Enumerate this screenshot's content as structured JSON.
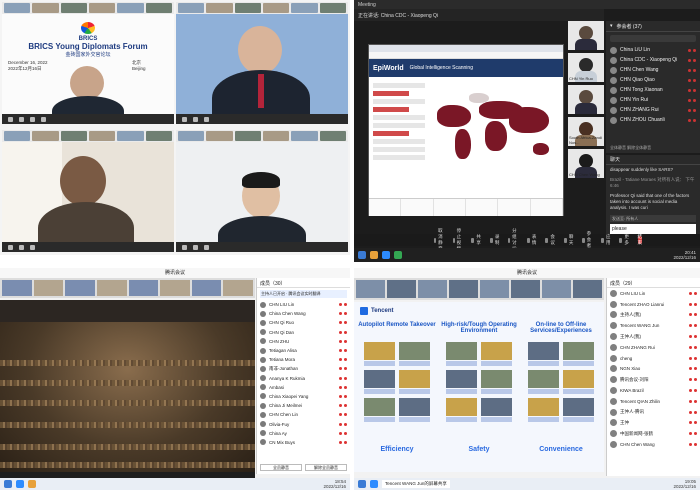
{
  "forum": {
    "org": "BRICS",
    "title": "BRICS Young Diplomats Forum",
    "subtitle_cn": "金砖国家外交官论坛",
    "date_en": "December 16, 2022",
    "date_cn": "2022年12月16日",
    "place_en": "Beijing",
    "place_cn": "北京"
  },
  "meeting_window": {
    "tab_title": "正在讲话: China CDC - Xiaopeng Qi",
    "meeting_title": "Meeting",
    "participants_title": "参会者 (37)",
    "participants": [
      {
        "name": "China LiU Lin",
        "sub": "(主持人, 我)"
      },
      {
        "name": "China CDC - Xiaopeng Qi",
        "sub": ""
      },
      {
        "name": "CHN Chen Wang",
        "sub": ""
      },
      {
        "name": "CHN Qiao Qiao",
        "sub": ""
      },
      {
        "name": "CHN Tong Xiaonan",
        "sub": ""
      },
      {
        "name": "CHN Yin Rui",
        "sub": ""
      },
      {
        "name": "CHN ZHANG Rui",
        "sub": ""
      },
      {
        "name": "CHN ZHOU Chuanli",
        "sub": ""
      }
    ],
    "participants_foot": "全体静音   解除全体静音",
    "chat_title": "聊天",
    "chat_messages": [
      "disappear suddenly like SARS?",
      "Brazil - Tatiane Moraes 对所有人说： 下午 6:46",
      "Professor Qi said that one of the factors taken into account is social media analysis. I was curi"
    ],
    "chat_to": "发送至: 所有人",
    "chat_input": "please",
    "video_labels": [
      "",
      "CHN Yin Ruo",
      "",
      "South Africa-Zandi Nos...",
      "CHN Chen Wang"
    ],
    "shared_site": {
      "logo": "EpiWorld",
      "subtitle": "Global Intelligence Scanning"
    },
    "toolbar": [
      "取消静音",
      "停止视频",
      "共享",
      "录制",
      "分组讨论",
      "表情",
      "会议",
      "聊天",
      "参会者",
      "应用",
      "更多",
      "结束"
    ],
    "clock": [
      "20:41",
      "2022/12/16"
    ]
  },
  "q3_window": {
    "title": "腾讯会议",
    "panel_title": "成员（30）",
    "banner": "主持人已开启 · 腾讯会议实时翻译",
    "members": [
      "CHN LIU Lin",
      "China Chen Wang",
      "CHN Qi Ruo",
      "CHN Qi Dan",
      "CHN ZHU",
      "Tetiagan Alisa",
      "Tetiana Mora",
      "南非-Jonathan",
      "Ananya K Rukmia",
      "Ambasi",
      "China Xiaopei Yang",
      "China Ji Meilmei",
      "CHN Chen Lin",
      "Olivia-Fuy",
      "China Ay",
      "CN Mix Buys"
    ],
    "buttons": [
      "全员静音",
      "解除全员静音"
    ],
    "clock": [
      "18:54",
      "2022/12/16"
    ]
  },
  "q4_window": {
    "title": "腾讯会议",
    "panel_title": "成员（29）",
    "members": [
      "CHN LIU Lin",
      "Tencent ZHAO Lianrui",
      "主持人(我)",
      "Tencent WANG Jun",
      "王仲人(我)",
      "CHN ZHANG Rui",
      "cheng",
      "NGN Xiao",
      "腾讯会议-刘阳",
      "KIWA Brazil",
      "Tencent QIAN Zhilin",
      "王仲人-腾讯",
      "王仲",
      "中国新闻网-张鹤",
      "CHN Chen Wang"
    ],
    "slide": {
      "brand": "Tencent",
      "cols": [
        {
          "title": "Autopilot Remote Takeover",
          "foot": "Efficiency"
        },
        {
          "title": "High-risk/Tough Operating Environment",
          "foot": "Safety"
        },
        {
          "title": "On-line to Off-line Services/Experiences",
          "foot": "Convenience"
        }
      ]
    },
    "taskbar_label": "Tencent WANG Jun的屏幕共享",
    "clock": [
      "19:05",
      "2022/12/16"
    ]
  },
  "colors": {
    "accent": "#1e6ae1",
    "map_red": "#7a1726",
    "end_red": "#d93a3a"
  }
}
